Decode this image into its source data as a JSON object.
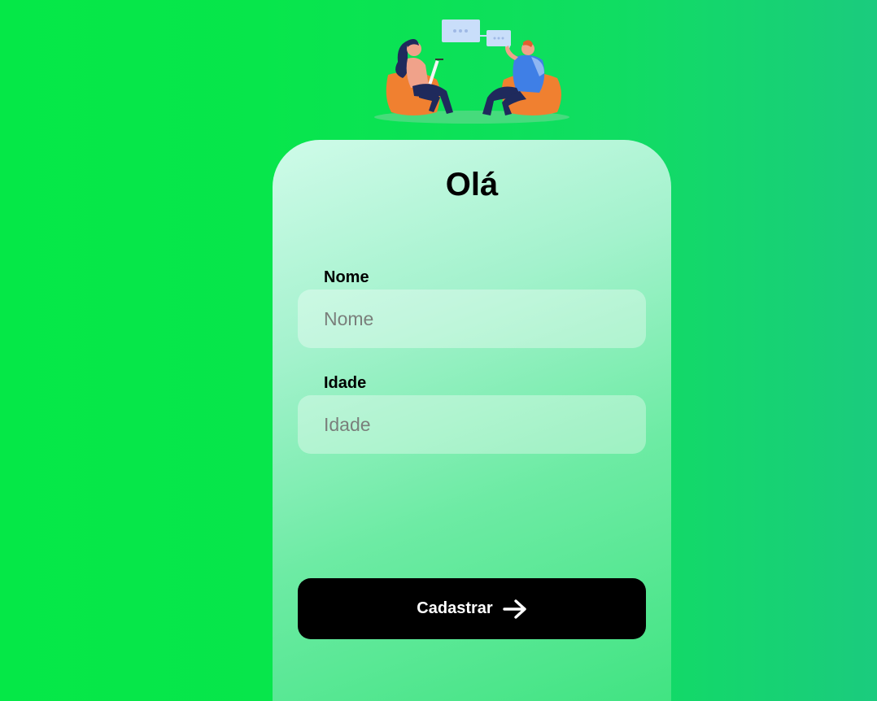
{
  "illustration": {
    "icon": "two-people-chatting-illustration",
    "colors": {
      "chair": "#f08030",
      "bubble": "#c9defa",
      "shirt_man": "#3f7fe6",
      "skin": "#f0a28a",
      "pants": "#1f2a5c"
    }
  },
  "card": {
    "title": "Olá"
  },
  "form": {
    "nome": {
      "label": "Nome",
      "placeholder": "Nome",
      "value": ""
    },
    "idade": {
      "label": "Idade",
      "placeholder": "Idade",
      "value": ""
    },
    "submit": {
      "label": "Cadastrar",
      "icon": "arrow-right-icon"
    }
  },
  "colors": {
    "background_left": "#05e847",
    "background_right": "#1bcb7e",
    "card_top": "#cffbe9",
    "card_bottom": "#3de37f",
    "button": "#000000",
    "button_text": "#ffffff"
  }
}
